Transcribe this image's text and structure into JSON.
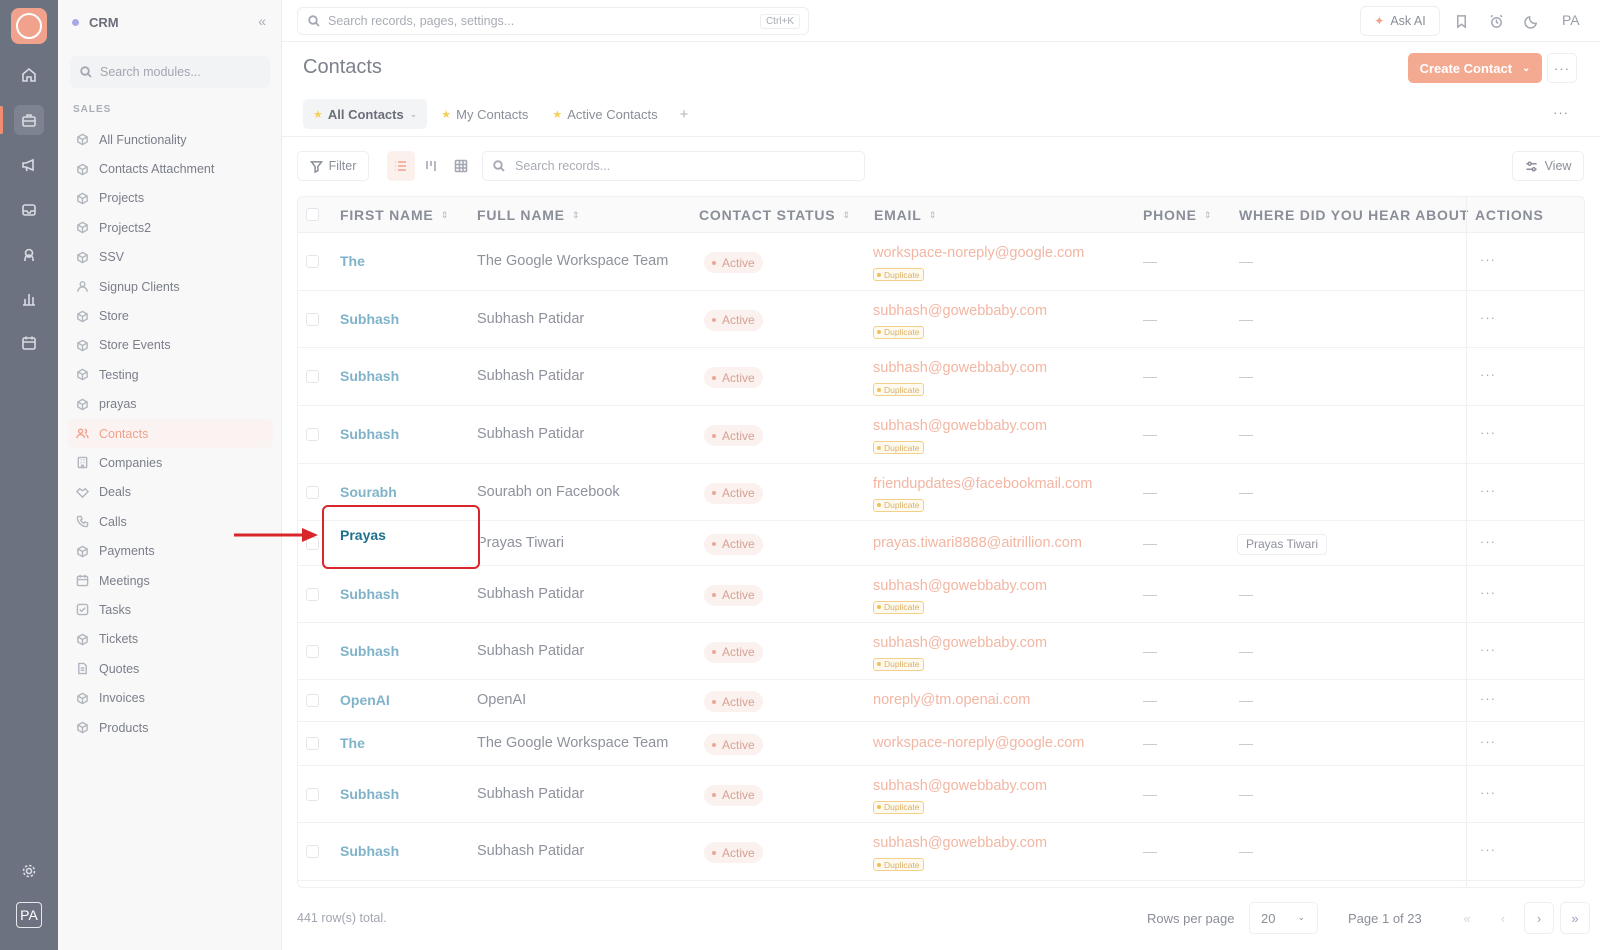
{
  "app": {
    "name": "CRM",
    "user_initials": "PA"
  },
  "sidebar": {
    "search_placeholder": "Search modules...",
    "section_label": "SALES",
    "items": [
      {
        "label": "All Functionality",
        "icon": "cube-icon"
      },
      {
        "label": "Contacts Attachment",
        "icon": "cube-icon"
      },
      {
        "label": "Projects",
        "icon": "cube-icon"
      },
      {
        "label": "Projects2",
        "icon": "cube-icon"
      },
      {
        "label": "SSV",
        "icon": "cube-icon"
      },
      {
        "label": "Signup Clients",
        "icon": "user-icon"
      },
      {
        "label": "Store",
        "icon": "cube-icon"
      },
      {
        "label": "Store Events",
        "icon": "cube-icon"
      },
      {
        "label": "Testing",
        "icon": "cube-icon"
      },
      {
        "label": "prayas",
        "icon": "cube-icon"
      },
      {
        "label": "Contacts",
        "icon": "users-icon",
        "active": true
      },
      {
        "label": "Companies",
        "icon": "building-icon"
      },
      {
        "label": "Deals",
        "icon": "handshake-icon"
      },
      {
        "label": "Calls",
        "icon": "phone-icon"
      },
      {
        "label": "Payments",
        "icon": "cube-icon"
      },
      {
        "label": "Meetings",
        "icon": "calendar-icon"
      },
      {
        "label": "Tasks",
        "icon": "checkbox-icon"
      },
      {
        "label": "Tickets",
        "icon": "cube-icon"
      },
      {
        "label": "Quotes",
        "icon": "document-icon"
      },
      {
        "label": "Invoices",
        "icon": "cube-icon"
      },
      {
        "label": "Products",
        "icon": "cube-icon"
      }
    ]
  },
  "topbar": {
    "search_placeholder": "Search records, pages, settings...",
    "shortcut": "Ctrl+K",
    "ask_ai": "Ask AI"
  },
  "page": {
    "title": "Contacts",
    "create_button": "Create Contact"
  },
  "views": {
    "tabs": [
      "All Contacts",
      "My Contacts",
      "Active Contacts"
    ]
  },
  "toolbar": {
    "filter": "Filter",
    "search_placeholder": "Search records...",
    "view": "View"
  },
  "table": {
    "columns": [
      "FIRST NAME",
      "FULL NAME",
      "CONTACT STATUS",
      "EMAIL",
      "PHONE",
      "WHERE DID YOU HEAR ABOUT",
      "ACTIONS"
    ],
    "empty": "—",
    "duplicate_label": "Duplicate",
    "rows": [
      {
        "first": "The",
        "full": "The Google Workspace Team",
        "status": "Active",
        "email": "workspace-noreply@google.com",
        "duplicate": true,
        "phone": "—",
        "where": "—"
      },
      {
        "first": "Subhash",
        "full": "Subhash Patidar",
        "status": "Active",
        "email": "subhash@gowebbaby.com",
        "duplicate": true,
        "phone": "—",
        "where": "—"
      },
      {
        "first": "Subhash",
        "full": "Subhash Patidar",
        "status": "Active",
        "email": "subhash@gowebbaby.com",
        "duplicate": true,
        "phone": "—",
        "where": "—"
      },
      {
        "first": "Subhash",
        "full": "Subhash Patidar",
        "status": "Active",
        "email": "subhash@gowebbaby.com",
        "duplicate": true,
        "phone": "—",
        "where": "—"
      },
      {
        "first": "Sourabh",
        "full": "Sourabh on Facebook",
        "status": "Active",
        "email": "friendupdates@facebookmail.com",
        "duplicate": true,
        "phone": "—",
        "where": "—"
      },
      {
        "first": "Prayas",
        "full": "Prayas Tiwari",
        "status": "Active",
        "email": "prayas.tiwari8888@aitrillion.com",
        "duplicate": false,
        "phone": "—",
        "where": "Prayas Tiwari",
        "highlighted": true
      },
      {
        "first": "Subhash",
        "full": "Subhash Patidar",
        "status": "Active",
        "email": "subhash@gowebbaby.com",
        "duplicate": true,
        "phone": "—",
        "where": "—"
      },
      {
        "first": "Subhash",
        "full": "Subhash Patidar",
        "status": "Active",
        "email": "subhash@gowebbaby.com",
        "duplicate": true,
        "phone": "—",
        "where": "—"
      },
      {
        "first": "OpenAI",
        "full": "OpenAI",
        "status": "Active",
        "email": "noreply@tm.openai.com",
        "duplicate": false,
        "phone": "—",
        "where": "—"
      },
      {
        "first": "The",
        "full": "The Google Workspace Team",
        "status": "Active",
        "email": "workspace-noreply@google.com",
        "duplicate": false,
        "phone": "—",
        "where": "—"
      },
      {
        "first": "Subhash",
        "full": "Subhash Patidar",
        "status": "Active",
        "email": "subhash@gowebbaby.com",
        "duplicate": true,
        "phone": "—",
        "where": "—"
      },
      {
        "first": "Subhash",
        "full": "Subhash Patidar",
        "status": "Active",
        "email": "subhash@gowebbaby.com",
        "duplicate": true,
        "phone": "—",
        "where": "—"
      }
    ]
  },
  "footer": {
    "total": "441 row(s) total.",
    "rows_per_page_label": "Rows per page",
    "rows_per_page": "20",
    "page_info": "Page 1 of 23"
  },
  "colors": {
    "accent": "#f4a991",
    "annotation": "#d8262b",
    "link": "#7fb3c9"
  }
}
